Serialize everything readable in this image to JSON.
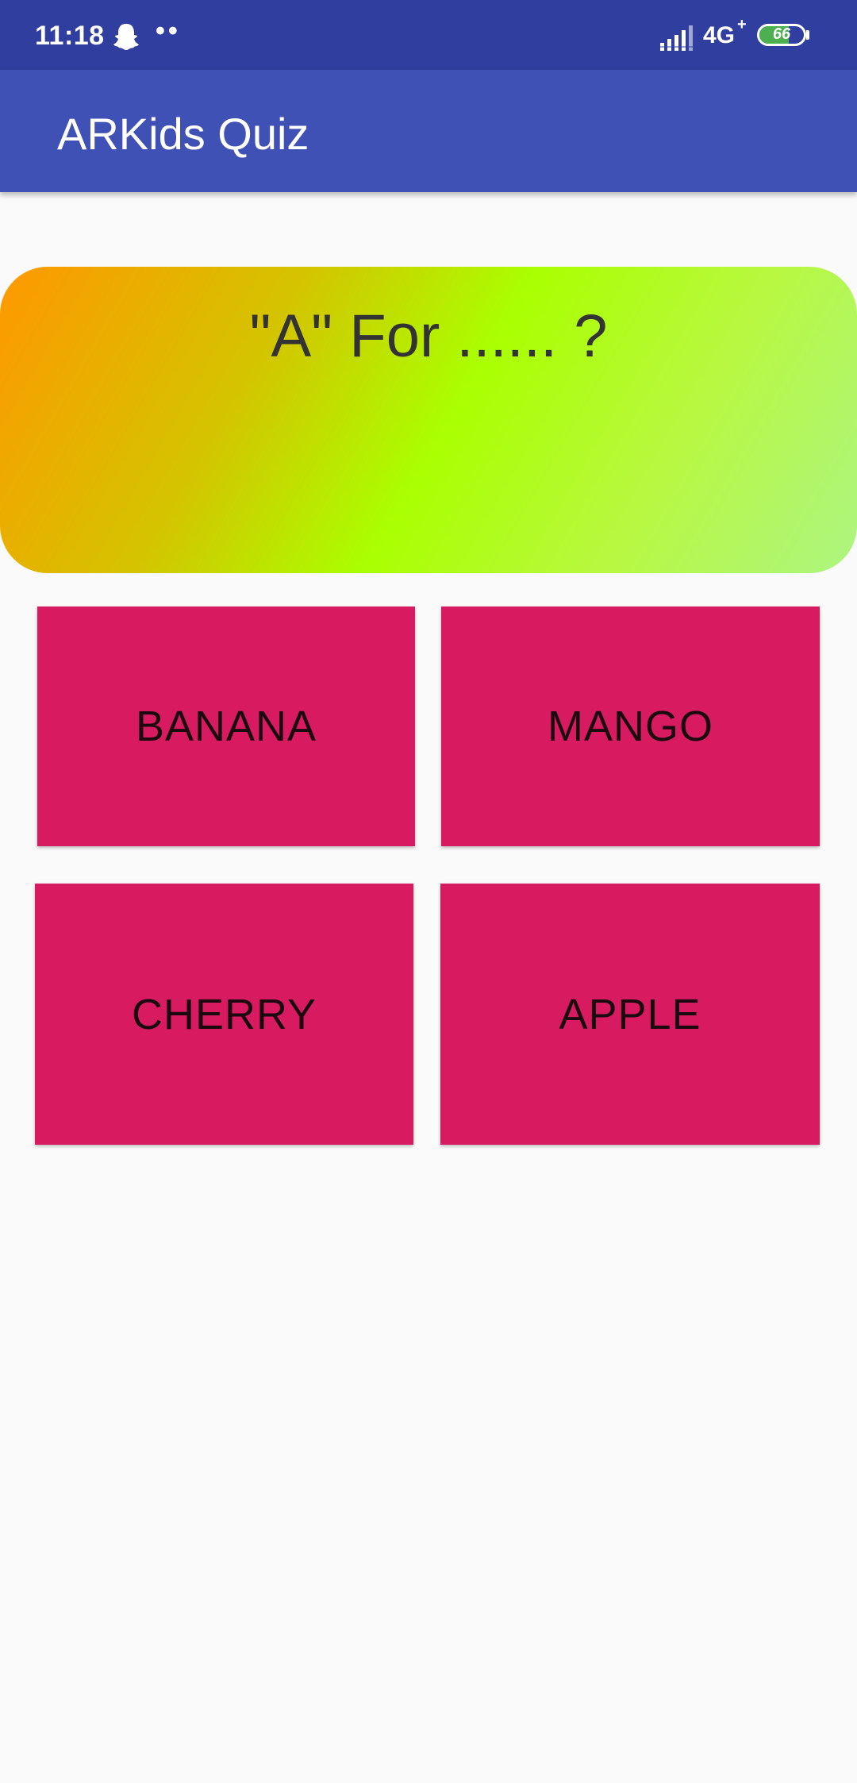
{
  "status_bar": {
    "time": "11:18",
    "notification_icons": [
      "snapchat-ghost-icon",
      "more-dots-icon"
    ],
    "dots": "••",
    "network": "4G",
    "network_plus": "+",
    "battery_level": "66",
    "battery_fraction": 0.66,
    "colors": {
      "background": "#303f9f",
      "battery_fill": "#4caf50"
    }
  },
  "app_bar": {
    "title": "ARKids Quiz",
    "color": "#3f51b5"
  },
  "question": {
    "text": "\"A\" For ...... ?"
  },
  "answers": [
    {
      "label": "BANANA"
    },
    {
      "label": "MANGO"
    },
    {
      "label": "CHERRY"
    },
    {
      "label": "APPLE"
    }
  ],
  "colors": {
    "answer_button": "#d81b60",
    "page_background": "#fafafa"
  }
}
